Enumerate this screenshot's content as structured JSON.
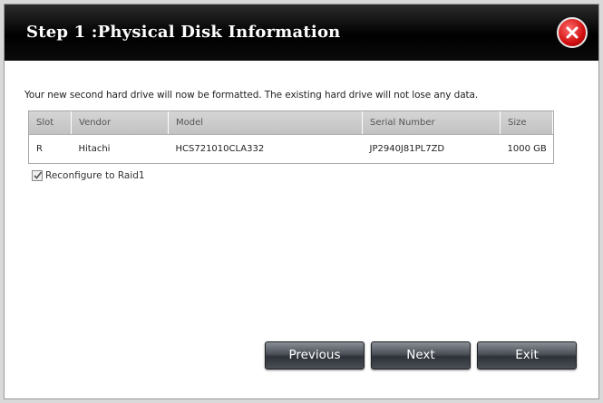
{
  "dialog": {
    "title": "Step 1 :Physical Disk Information",
    "message": "Your new second hard drive will now be formatted. The existing hard drive will not lose any data."
  },
  "table": {
    "columns": [
      "Slot",
      "Vendor",
      "Model",
      "Serial Number",
      "Size"
    ],
    "rows": [
      [
        "R",
        "Hitachi",
        "HCS721010CLA332",
        "JP2940J81PL7ZD",
        "1000 GB"
      ]
    ]
  },
  "options": {
    "reconfigure_label": "Reconfigure to Raid1",
    "reconfigure_checked": true
  },
  "buttons": {
    "previous": "Previous",
    "next": "Next",
    "exit": "Exit"
  },
  "colors": {
    "titlebar": "#000000",
    "close": "#d11010",
    "button": "#4b5058"
  }
}
